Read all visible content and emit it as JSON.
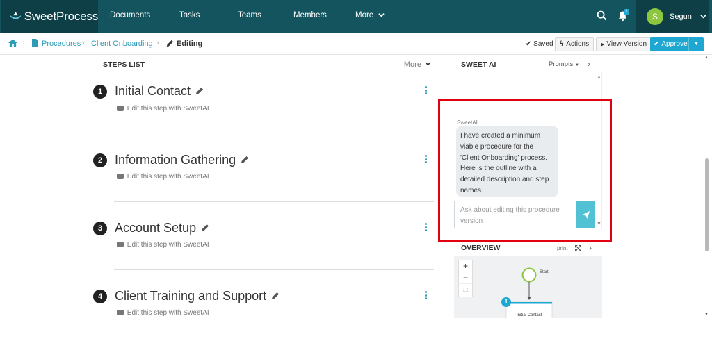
{
  "app": {
    "logo_brand": "SweetProcess"
  },
  "nav": {
    "items": [
      {
        "label": "Documents"
      },
      {
        "label": "Tasks"
      },
      {
        "label": "Teams"
      },
      {
        "label": "Members"
      },
      {
        "label": "More"
      }
    ],
    "notification_count": "1",
    "user": {
      "initial": "S",
      "name": "Segun"
    }
  },
  "breadcrumb": {
    "items": [
      {
        "label": "Procedures"
      },
      {
        "label": "Client Onboarding"
      }
    ],
    "current": "Editing"
  },
  "toolbar": {
    "saved_label": "Saved",
    "actions_label": "Actions",
    "view_version_label": "View Version",
    "approve_label": "Approve"
  },
  "steps_list": {
    "title": "STEPS LIST",
    "more_label": "More",
    "edit_with_ai_label": "Edit this step with SweetAI",
    "steps": [
      {
        "number": "1",
        "title": "Initial Contact"
      },
      {
        "number": "2",
        "title": "Information Gathering"
      },
      {
        "number": "3",
        "title": "Account Setup"
      },
      {
        "number": "4",
        "title": "Client Training and Support"
      }
    ]
  },
  "sweet_ai": {
    "title": "SWEET AI",
    "prompts_label": "Prompts",
    "sender": "SweetAI",
    "message": "I have created a minimum viable procedure for the 'Client Onboarding' process. Here is the outline with a detailed description and step names.",
    "input_placeholder": "Ask about editing this procedure version"
  },
  "overview": {
    "title": "OVERVIEW",
    "print_label": "print",
    "start_label": "Start",
    "node_number": "1",
    "node_label": "Initial Contact"
  },
  "colors": {
    "topnav": "#13545e",
    "topnav_dark": "#0e3f47",
    "link": "#2c9bb5",
    "approve": "#1ea7d1",
    "highlight_box": "#e10010",
    "avatar": "#8dc63f"
  }
}
